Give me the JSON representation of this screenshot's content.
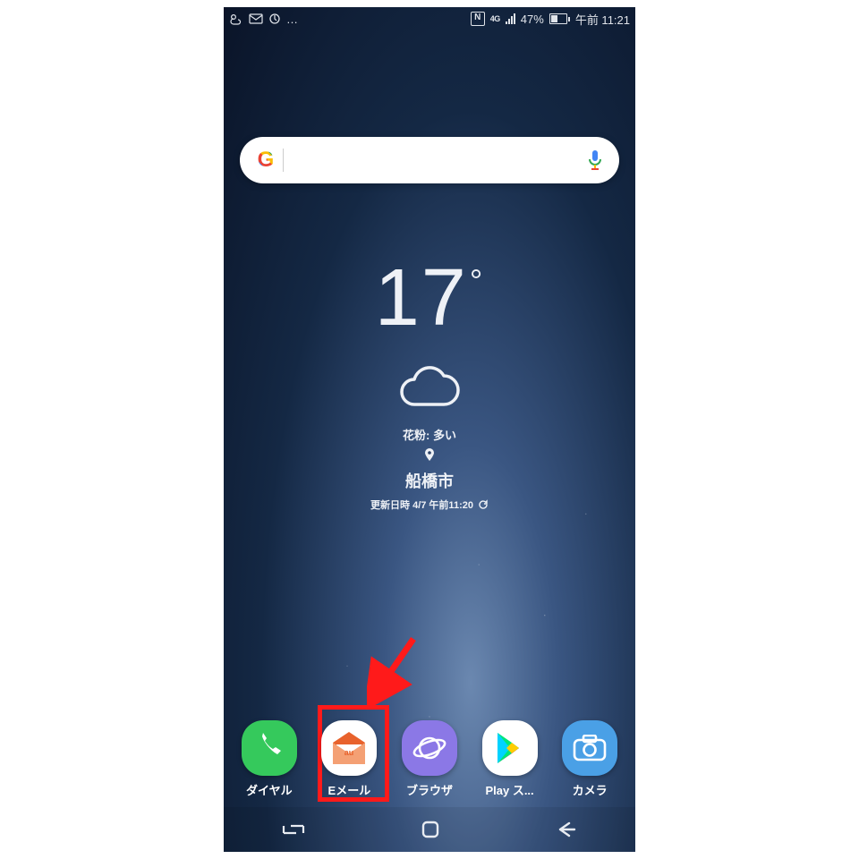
{
  "status": {
    "network": "4G",
    "battery_pct": "47%",
    "battery_fill_pct": 47,
    "time": "午前 11:21"
  },
  "search": {
    "placeholder": ""
  },
  "weather": {
    "temp": "17",
    "degree": "°",
    "pollen": "花粉: 多い",
    "city": "船橋市",
    "updated": "更新日時 4/7 午前11:20"
  },
  "dock": {
    "items": [
      {
        "label": "ダイヤル",
        "bg": "#35c95c",
        "kind": "phone"
      },
      {
        "label": "Eメール",
        "bg": "#ffffff",
        "kind": "aumail"
      },
      {
        "label": "ブラウザ",
        "bg": "#8b78e6",
        "kind": "planet"
      },
      {
        "label": "Play ス...",
        "bg": "#ffffff",
        "kind": "play"
      },
      {
        "label": "カメラ",
        "bg": "#4aa0e6",
        "kind": "camera"
      }
    ]
  },
  "colors": {
    "highlight": "#ff1a1a"
  }
}
